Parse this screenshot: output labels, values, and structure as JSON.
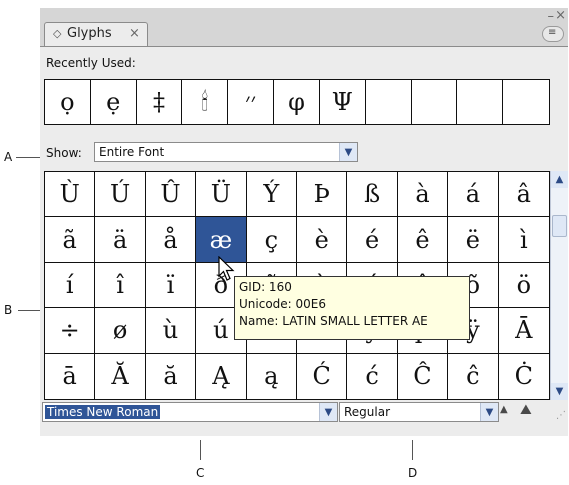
{
  "tab": {
    "label": "Glyphs",
    "close": "×",
    "diamond": "◇"
  },
  "window": {
    "minimize": "–",
    "close": "×",
    "menu": "≡"
  },
  "recent": {
    "label": "Recently Used:",
    "glyphs": [
      "ọ",
      "ẹ",
      "‡",
      "🕯",
      "׳׳",
      "φ",
      "Ψ",
      "",
      "",
      "",
      ""
    ]
  },
  "show": {
    "label": "Show:",
    "value": "Entire Font"
  },
  "grid": {
    "glyphs": [
      "Ù",
      "Ú",
      "Û",
      "Ü",
      "Ý",
      "Þ",
      "ß",
      "à",
      "á",
      "â",
      "ã",
      "ä",
      "å",
      "æ",
      "ç",
      "è",
      "é",
      "ê",
      "ë",
      "ì",
      "í",
      "î",
      "ï",
      "ð",
      "ñ",
      "ò",
      "ó",
      "ô",
      "õ",
      "ö",
      "÷",
      "ø",
      "ù",
      "ú",
      "û",
      "ü",
      "ý",
      "þ",
      "ÿ",
      "Ā",
      "ā",
      "Ă",
      "ă",
      "Ą",
      "ą",
      "Ć",
      "ć",
      "Ĉ",
      "ĉ",
      "Ċ"
    ],
    "selected_index": 13
  },
  "tooltip": {
    "gid": "GID: 160",
    "unicode": "Unicode: 00E6",
    "name": "Name: LATIN SMALL LETTER AE"
  },
  "footer": {
    "font": "Times New Roman",
    "style": "Regular"
  },
  "callouts": {
    "a": "A",
    "b": "B",
    "c": "C",
    "d": "D"
  },
  "icons": {
    "dropdown": "chevron-down-icon",
    "zoom_out": "mountain-small-icon",
    "zoom_in": "mountain-large-icon"
  },
  "colors": {
    "selection": "#2f5597",
    "tooltip_bg": "#ffffe1",
    "panel_bg": "#ececec"
  }
}
